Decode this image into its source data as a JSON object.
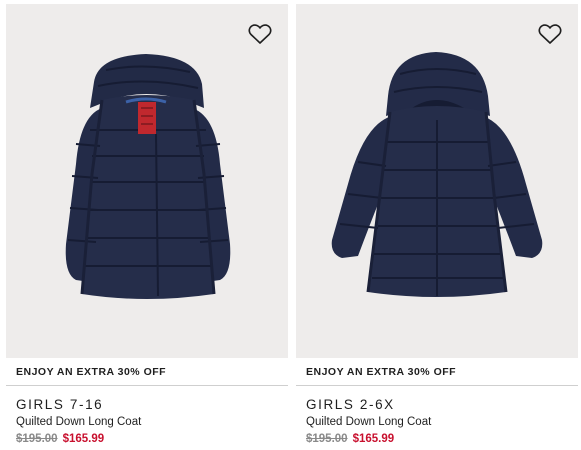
{
  "products": [
    {
      "promo": "ENJOY AN EXTRA 30% OFF",
      "brand": "GIRLS 7-16",
      "name": "Quilted Down Long Coat",
      "price_original": "$195.00",
      "price_sale": "$165.99",
      "image": "navy-quilted-long-coat-open",
      "icon": "heart-outline"
    },
    {
      "promo": "ENJOY AN EXTRA 30% OFF",
      "brand": "GIRLS 2-6X",
      "name": "Quilted Down Long Coat",
      "price_original": "$195.00",
      "price_sale": "$165.99",
      "image": "navy-quilted-long-coat-closed",
      "icon": "heart-outline"
    }
  ],
  "colors": {
    "coat_navy": "#1f2640",
    "image_bg": "#eeeceb",
    "sale_price": "#c8102e",
    "original_price": "#8a8a8a",
    "divider": "#cfcfcf"
  }
}
